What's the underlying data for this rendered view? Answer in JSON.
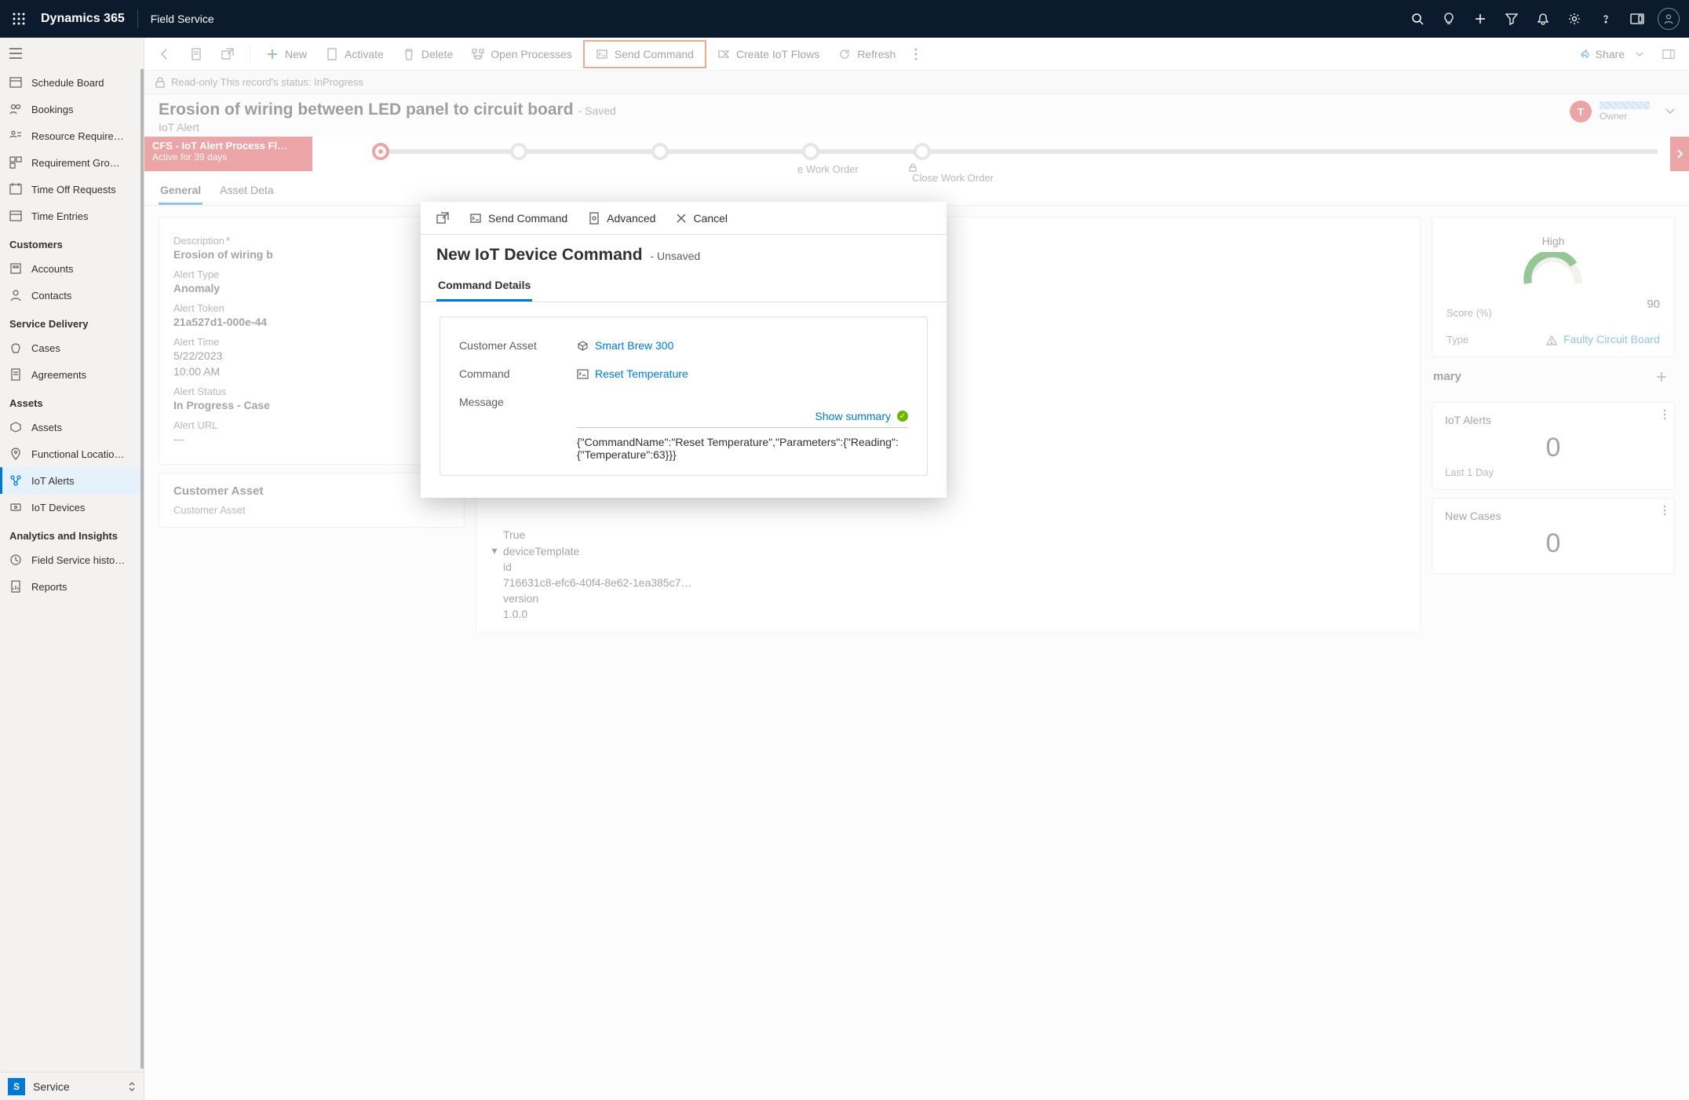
{
  "topbar": {
    "brand": "Dynamics 365",
    "area": "Field Service"
  },
  "sidebar": {
    "items_a": [
      "Schedule Board",
      "Bookings",
      "Resource Require…",
      "Requirement Gro…",
      "Time Off Requests",
      "Time Entries"
    ],
    "heading_customers": "Customers",
    "items_customers": [
      "Accounts",
      "Contacts"
    ],
    "heading_service": "Service Delivery",
    "items_service": [
      "Cases",
      "Agreements"
    ],
    "heading_assets": "Assets",
    "items_assets": [
      "Assets",
      "Functional Locatio…",
      "IoT Alerts",
      "IoT Devices"
    ],
    "heading_ai": "Analytics and Insights",
    "items_ai": [
      "Field Service histo…",
      "Reports"
    ],
    "footer_letter": "S",
    "footer_label": "Service"
  },
  "cmdbar": {
    "new": "New",
    "activate": "Activate",
    "delete": "Delete",
    "open_processes": "Open Processes",
    "send_command": "Send Command",
    "create_iot_flows": "Create IoT Flows",
    "refresh": "Refresh",
    "share": "Share"
  },
  "lockbar": {
    "text": "Read-only This record's status: InProgress"
  },
  "record": {
    "title": "Erosion of wiring between LED panel to circuit board",
    "saved": "- Saved",
    "subtitle": "IoT Alert",
    "owner_initial": "T",
    "owner_label": "Owner"
  },
  "bpf": {
    "stage_title": "CFS - IoT Alert Process Fl…",
    "stage_sub": "Active for 39 days",
    "s4": "e Work Order",
    "s5": "Close Work Order"
  },
  "tabs": {
    "general": "General",
    "asset_details": "Asset Deta"
  },
  "fields": {
    "description_lbl": "Description",
    "description_val": "Erosion of wiring b",
    "alert_type_lbl": "Alert Type",
    "alert_type_val": "Anomaly",
    "alert_token_lbl": "Alert Token",
    "alert_token_val": "21a527d1-000e-44",
    "alert_time_lbl": "Alert Time",
    "alert_time_date": "5/22/2023",
    "alert_time_time": "10:00 AM",
    "alert_status_lbl": "Alert Status",
    "alert_status_val": "In Progress - Case",
    "alert_url_lbl": "Alert URL",
    "alert_url_val": "---",
    "customer_asset_hdr": "Customer Asset",
    "customer_asset_lbl": "Customer Asset"
  },
  "colB": {
    "true": "True",
    "device_template": "deviceTemplate",
    "id_lbl": "id",
    "id_val": "716631c8-efc6-40f4-8e62-1ea385c7…",
    "version_lbl": "version",
    "version_val": "1.0.0"
  },
  "colC": {
    "priority_label": "High",
    "score_lbl": "Score (%)",
    "score_val": "90",
    "type_lbl": "Type",
    "type_val": "Faulty Circuit Board",
    "summary_title": "mary",
    "iot_alerts_title": "IoT Alerts",
    "iot_alerts_val": "0",
    "last1day": "Last 1 Day",
    "new_cases_title": "New Cases",
    "new_cases_val": "0"
  },
  "modal": {
    "cmd_send": "Send Command",
    "cmd_adv": "Advanced",
    "cmd_cancel": "Cancel",
    "title": "New IoT Device Command",
    "status": "- Unsaved",
    "tab": "Command Details",
    "customer_asset_lbl": "Customer Asset",
    "customer_asset_val": "Smart Brew 300",
    "command_lbl": "Command",
    "command_val": "Reset Temperature",
    "message_lbl": "Message",
    "show_summary": "Show summary",
    "message_val": "{\"CommandName\":\"Reset Temperature\",\"Parameters\":{\"Reading\":{\"Temperature\":63}}}"
  }
}
